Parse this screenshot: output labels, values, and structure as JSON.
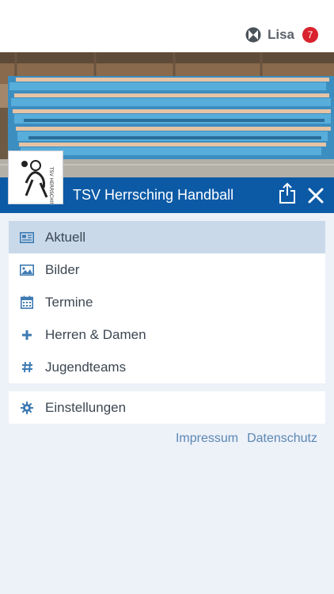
{
  "header": {
    "user_name": "Lisa",
    "badge_count": "7",
    "logo_icon": "app-logo-icon"
  },
  "hero": {
    "club_name": "TSV Herrsching Handball",
    "share_icon": "share-icon",
    "close_icon": "close-icon",
    "accent_color": "#0c5aa6"
  },
  "menu": {
    "items": [
      {
        "label": "Aktuell",
        "icon": "newspaper-icon",
        "active": true
      },
      {
        "label": "Bilder",
        "icon": "image-icon"
      },
      {
        "label": "Termine",
        "icon": "calendar-icon"
      },
      {
        "label": "Herren & Damen",
        "icon": "plus-icon"
      },
      {
        "label": "Jugendteams",
        "icon": "hashtag-icon"
      }
    ],
    "settings": {
      "label": "Einstellungen",
      "icon": "gear-icon"
    }
  },
  "footer": {
    "impressum": "Impressum",
    "datenschutz": "Datenschutz"
  }
}
